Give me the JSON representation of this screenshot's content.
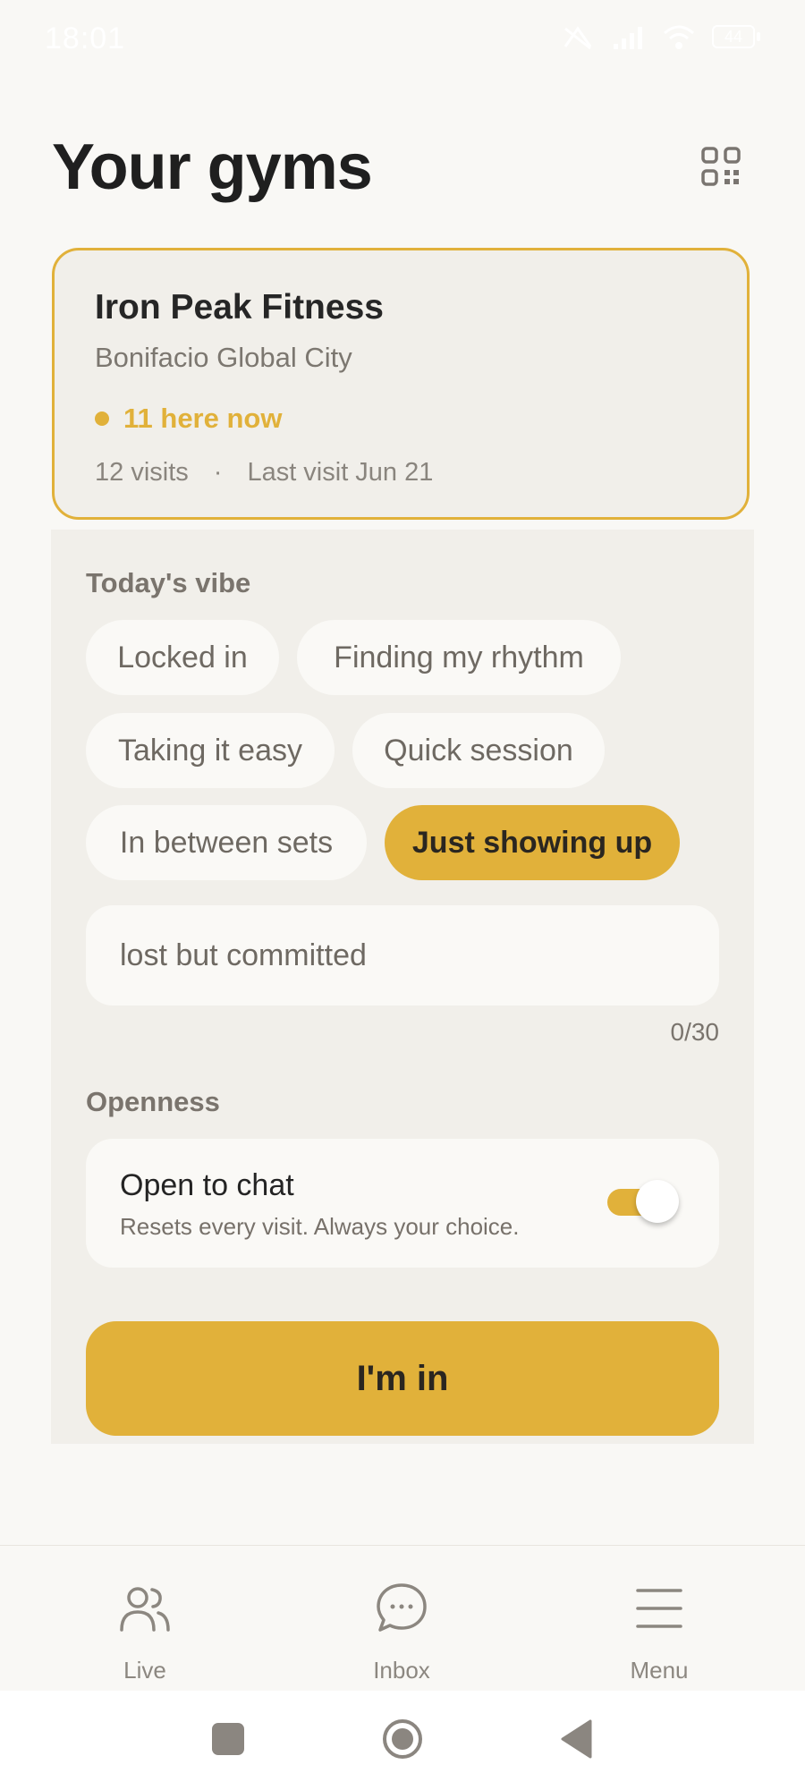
{
  "status_bar": {
    "time": "18:01",
    "battery": "44"
  },
  "header": {
    "title": "Your gyms"
  },
  "gym": {
    "name": "Iron Peak Fitness",
    "location": "Bonifacio Global City",
    "presence": "11 here now",
    "visits": "12 visits",
    "separator": "·",
    "last_visit": "Last visit Jun 21"
  },
  "vibe": {
    "label": "Today's vibe",
    "chips": [
      {
        "label": "Locked in",
        "selected": false
      },
      {
        "label": "Finding my rhythm",
        "selected": false
      },
      {
        "label": "Taking it easy",
        "selected": false
      },
      {
        "label": "Quick session",
        "selected": false
      },
      {
        "label": "In between sets",
        "selected": false
      },
      {
        "label": "Just showing up",
        "selected": true
      }
    ],
    "input_placeholder": "lost but committed",
    "char_count": "0/30"
  },
  "openness": {
    "label": "Openness",
    "title": "Open to chat",
    "subtitle": "Resets every visit. Always your choice.",
    "toggle_on": true
  },
  "primary_action": {
    "label": "I'm in"
  },
  "nav": {
    "items": [
      {
        "label": "Live",
        "icon": "users-icon"
      },
      {
        "label": "Inbox",
        "icon": "chat-bubble-icon"
      },
      {
        "label": "Menu",
        "icon": "menu-icon"
      }
    ]
  },
  "colors": {
    "accent": "#E1B13A",
    "background": "#F9F8F5",
    "panel": "#F1EFEA"
  }
}
